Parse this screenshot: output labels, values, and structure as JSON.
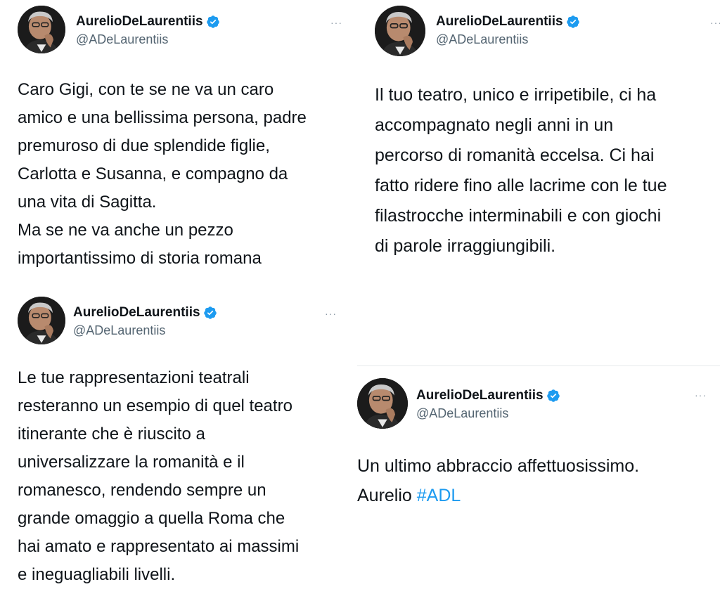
{
  "tweets": [
    {
      "author": "AurelioDeLaurentiis",
      "handle": "@ADeLaurentiis",
      "more": "···",
      "lines": [
        "Caro Gigi, con te se ne va un caro",
        "amico e una bellissima persona, padre",
        "premuroso di due splendide figlie,",
        "Carlotta e Susanna, e compagno da",
        "una vita di Sagitta.",
        "Ma se ne va anche un pezzo",
        "importantissimo di storia romana"
      ]
    },
    {
      "author": "AurelioDeLaurentiis",
      "handle": "@ADeLaurentiis",
      "more": "···",
      "lines": [
        "Il tuo teatro, unico e irripetibile, ci ha",
        "accompagnato negli anni in un",
        "percorso di romanità eccelsa. Ci hai",
        "fatto ridere fino alle lacrime con le tue",
        "filastrocche interminabili e con giochi",
        "di parole irraggiungibili."
      ]
    },
    {
      "author": "AurelioDeLaurentiis",
      "handle": "@ADeLaurentiis",
      "more": "···",
      "lines": [
        "Le tue rappresentazioni teatrali",
        "resteranno un esempio di quel teatro",
        "itinerante che è riuscito a",
        "universalizzare la romanità e il",
        "romanesco, rendendo sempre un",
        "grande omaggio a quella Roma che",
        "hai amato e rappresentato ai massimi",
        "e ineguagliabili livelli."
      ]
    },
    {
      "author": "AurelioDeLaurentiis",
      "handle": "@ADeLaurentiis",
      "more": "···",
      "line1": "Un ultimo abbraccio affettuosissimo.",
      "line2_text": "Aurelio ",
      "hashtag": "#ADL"
    }
  ],
  "colors": {
    "verified": "#1d9bf0",
    "hashtag": "#1d9bf0",
    "handle": "#536471"
  }
}
